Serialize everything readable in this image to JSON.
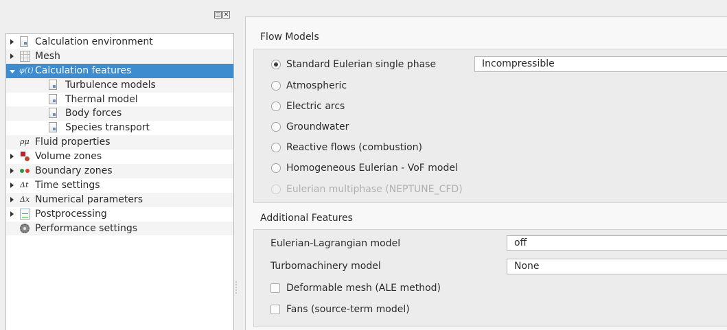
{
  "dock": {
    "float_icon": "float-icon",
    "close_icon": "close-icon"
  },
  "tree": {
    "items": [
      {
        "label": "Calculation environment",
        "icon": "document-icon"
      },
      {
        "label": "Mesh",
        "icon": "mesh-grid-icon"
      },
      {
        "label": "Calculation features",
        "icon": "phi-icon",
        "icon_text": "φ(t)",
        "selected": true
      },
      {
        "label": "Turbulence models",
        "icon": "document-icon"
      },
      {
        "label": "Thermal model",
        "icon": "document-icon"
      },
      {
        "label": "Body forces",
        "icon": "document-icon"
      },
      {
        "label": "Species transport",
        "icon": "document-icon"
      },
      {
        "label": "Fluid properties",
        "icon": "rho-mu-icon",
        "icon_text": "ρμ"
      },
      {
        "label": "Volume zones",
        "icon": "volume-zones-icon"
      },
      {
        "label": "Boundary zones",
        "icon": "boundary-zones-icon"
      },
      {
        "label": "Time settings",
        "icon": "delta-t-icon",
        "icon_text": "Δt"
      },
      {
        "label": "Numerical parameters",
        "icon": "delta-x-icon",
        "icon_text": "Δx"
      },
      {
        "label": "Postprocessing",
        "icon": "chart-icon"
      },
      {
        "label": "Performance settings",
        "icon": "gear-icon"
      }
    ]
  },
  "flow_models": {
    "title": "Flow Models",
    "options": [
      {
        "label": "Standard Eulerian single phase",
        "checked": true,
        "enabled": true
      },
      {
        "label": "Atmospheric",
        "checked": false,
        "enabled": true
      },
      {
        "label": "Electric arcs",
        "checked": false,
        "enabled": true
      },
      {
        "label": "Groundwater",
        "checked": false,
        "enabled": true
      },
      {
        "label": "Reactive flows (combustion)",
        "checked": false,
        "enabled": true
      },
      {
        "label": "Homogeneous Eulerian - VoF model",
        "checked": false,
        "enabled": true
      },
      {
        "label": "Eulerian multiphase (NEPTUNE_CFD)",
        "checked": false,
        "enabled": false
      }
    ],
    "compressibility_value": "Incompressible"
  },
  "additional_features": {
    "title": "Additional Features",
    "lagrangian_label": "Eulerian-Lagrangian model",
    "lagrangian_value": "off",
    "turbomachinery_label": "Turbomachinery model",
    "turbomachinery_value": "None",
    "ale_label": "Deformable mesh (ALE method)",
    "ale_checked": false,
    "fans_label": "Fans (source-term model)",
    "fans_checked": false
  },
  "colors": {
    "selection": "#3d8ccf",
    "pane_bg": "#f8f8f8",
    "group_bg": "#ececec"
  }
}
